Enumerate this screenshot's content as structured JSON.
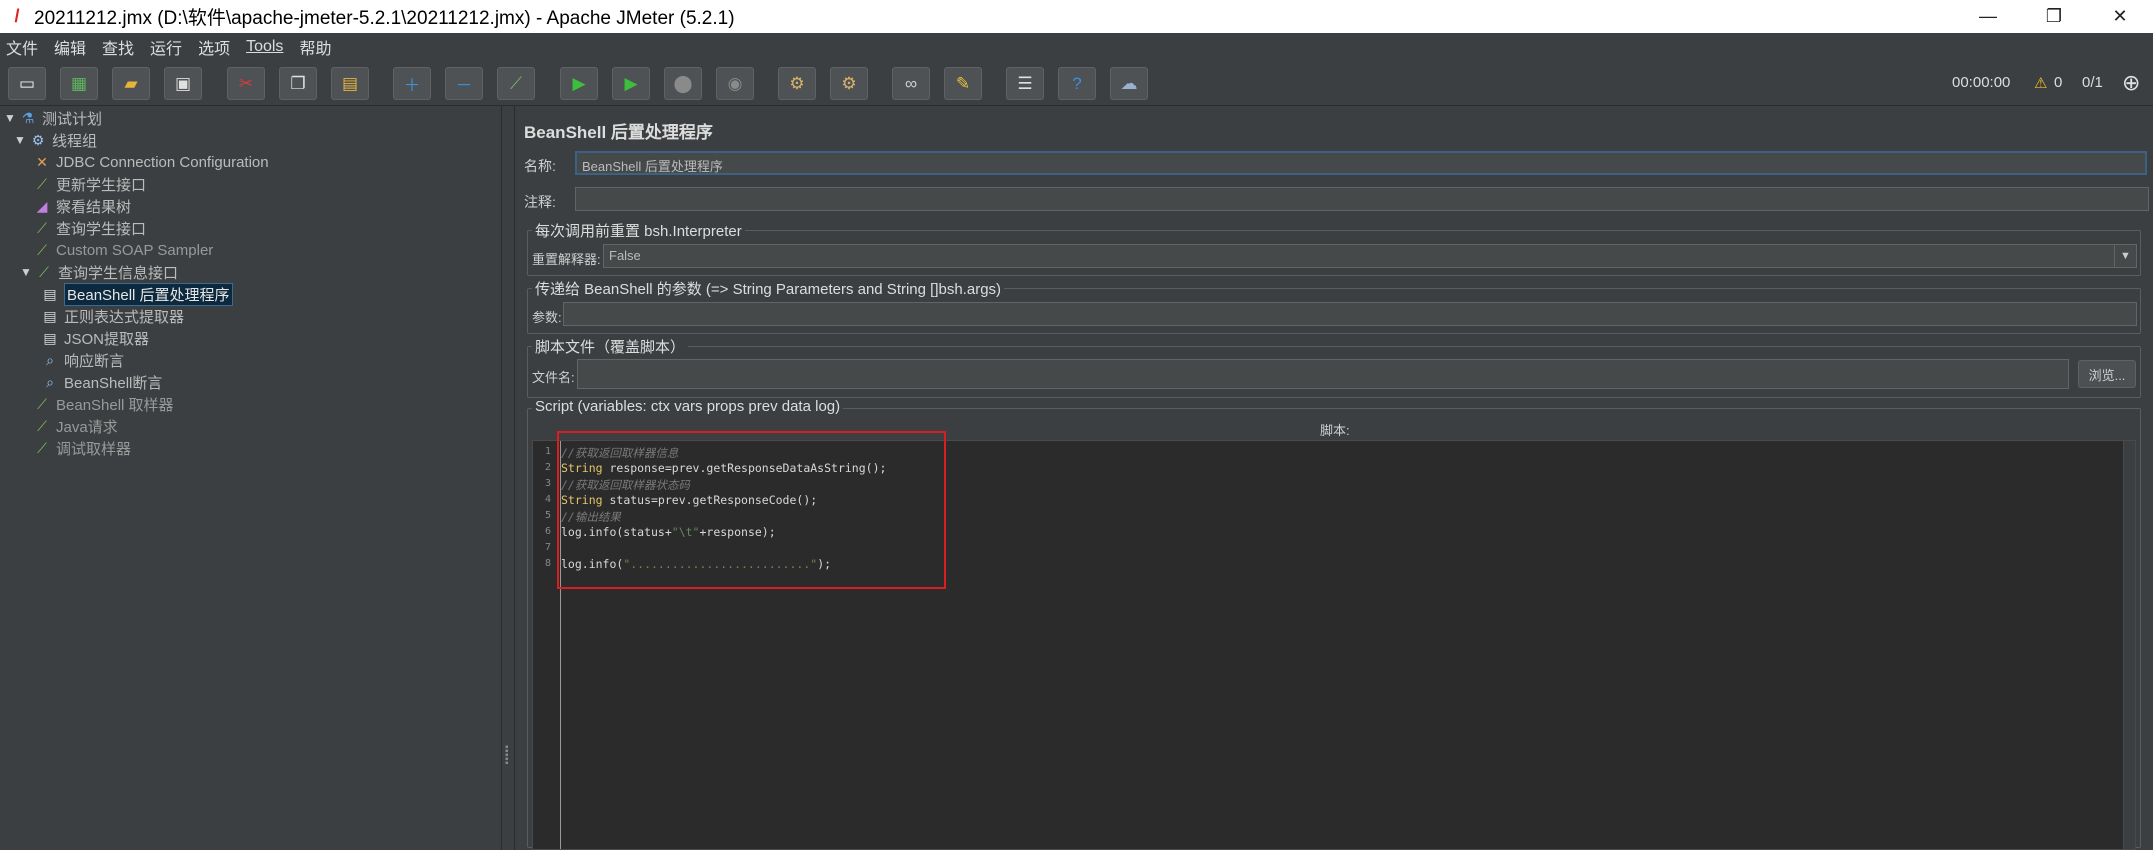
{
  "window": {
    "title": "20211212.jmx (D:\\软件\\apache-jmeter-5.2.1\\20211212.jmx) - Apache JMeter (5.2.1)",
    "minimize": "—",
    "maximize": "❐",
    "close": "✕"
  },
  "menu": [
    "文件",
    "编辑",
    "查找",
    "运行",
    "选项",
    "Tools",
    "帮助"
  ],
  "toolbar": {
    "timer": "00:00:00",
    "warnings": "0",
    "threads": "0/1"
  },
  "tree": [
    {
      "label": "测试计划",
      "icon": "test-plan-icon"
    },
    {
      "label": "线程组",
      "icon": "gear-icon"
    },
    {
      "label": "JDBC Connection Configuration",
      "icon": "wrench-icon"
    },
    {
      "label": "更新学生接口",
      "icon": "pipette-icon"
    },
    {
      "label": "察看结果树",
      "icon": "chart-icon"
    },
    {
      "label": "查询学生接口",
      "icon": "pipette-icon"
    },
    {
      "label": "Custom SOAP Sampler",
      "icon": "pipette-icon"
    },
    {
      "label": "查询学生信息接口",
      "icon": "pipette-icon"
    },
    {
      "label": "BeanShell 后置处理程序",
      "icon": "document-icon"
    },
    {
      "label": "正则表达式提取器",
      "icon": "document-icon"
    },
    {
      "label": "JSON提取器",
      "icon": "document-icon"
    },
    {
      "label": "响应断言",
      "icon": "magnifier-icon"
    },
    {
      "label": "BeanShell断言",
      "icon": "magnifier-icon"
    },
    {
      "label": "BeanShell 取样器",
      "icon": "pipette-icon"
    },
    {
      "label": "Java请求",
      "icon": "pipette-icon"
    },
    {
      "label": "调试取样器",
      "icon": "pipette-icon"
    }
  ],
  "panel": {
    "title": "BeanShell 后置处理程序",
    "name_label": "名称:",
    "name_value": "BeanShell 后置处理程序",
    "comment_label": "注释:",
    "comment_value": "",
    "reset_group": "每次调用前重置 bsh.Interpreter",
    "reset_label": "重置解释器:",
    "reset_value": "False",
    "params_group": "传递给 BeanShell 的参数 (=> String Parameters and String []bsh.args)",
    "params_label": "参数:",
    "params_value": "",
    "file_group": "脚本文件（覆盖脚本）",
    "file_label": "文件名:",
    "file_value": "",
    "browse": "浏览...",
    "script_group": "Script (variables: ctx vars props prev data log)",
    "script_label": "脚本:"
  },
  "script_lines": [
    {
      "n": "1",
      "parts": [
        {
          "t": "//获取返回取样器信息",
          "c": "cmt"
        }
      ]
    },
    {
      "n": "2",
      "parts": [
        {
          "t": "String",
          "c": "kw"
        },
        {
          "t": " response=prev.getResponseDataAsString();",
          "c": ""
        }
      ]
    },
    {
      "n": "3",
      "parts": [
        {
          "t": "//获取返回取样器状态码",
          "c": "cmt"
        }
      ]
    },
    {
      "n": "4",
      "parts": [
        {
          "t": "String",
          "c": "kw"
        },
        {
          "t": " status=prev.getResponseCode();",
          "c": ""
        }
      ]
    },
    {
      "n": "5",
      "parts": [
        {
          "t": "//输出结果",
          "c": "cmt"
        }
      ]
    },
    {
      "n": "6",
      "parts": [
        {
          "t": "log.info(status+",
          "c": ""
        },
        {
          "t": "\"\\t\"",
          "c": "str"
        },
        {
          "t": "+response);",
          "c": ""
        }
      ]
    },
    {
      "n": "7",
      "parts": []
    },
    {
      "n": "8",
      "parts": [
        {
          "t": "log.info(",
          "c": ""
        },
        {
          "t": "\"..........................\"",
          "c": "str"
        },
        {
          "t": ");",
          "c": ""
        }
      ]
    }
  ]
}
